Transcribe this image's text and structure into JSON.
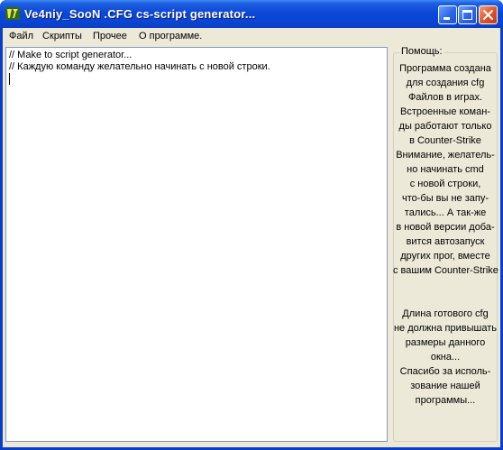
{
  "window": {
    "title": "Ve4niy_SooN .CFG cs-script generator...",
    "colors": {
      "titlebar": "#0a45d4",
      "close_button": "#e0522a",
      "face": "#ece9d8"
    }
  },
  "title_buttons": {
    "minimize_icon": "minimize-icon",
    "maximize_icon": "maximize-icon",
    "close_icon": "close-icon"
  },
  "menu": {
    "items": [
      "Файл",
      "Скрипты",
      "Прочее",
      "О программе."
    ]
  },
  "editor": {
    "lines": [
      "// Make to script generator...",
      "// Каждую команду желательно начинать с новой строки."
    ]
  },
  "help": {
    "legend": "Помощь:",
    "lines_top": [
      "Программа создана",
      "для создания cfg",
      "Файлов в играх.",
      "Встроенные коман-",
      "ды работают только",
      "в Counter-Strike",
      "Внимание, желатель-",
      "но начинать cmd",
      "с новой строки,",
      "что-бы вы не запу-",
      "тались... А так-же",
      "в новой версии доба-",
      "вится автозапуск",
      "других прог, вместе",
      "с вашим Counter-Strike"
    ],
    "lines_bottom": [
      "Длина готового cfg",
      "не должна привышать",
      "размеры данного",
      "окна...",
      "Спасибо за исполь-",
      "зование нашей",
      "программы..."
    ]
  }
}
